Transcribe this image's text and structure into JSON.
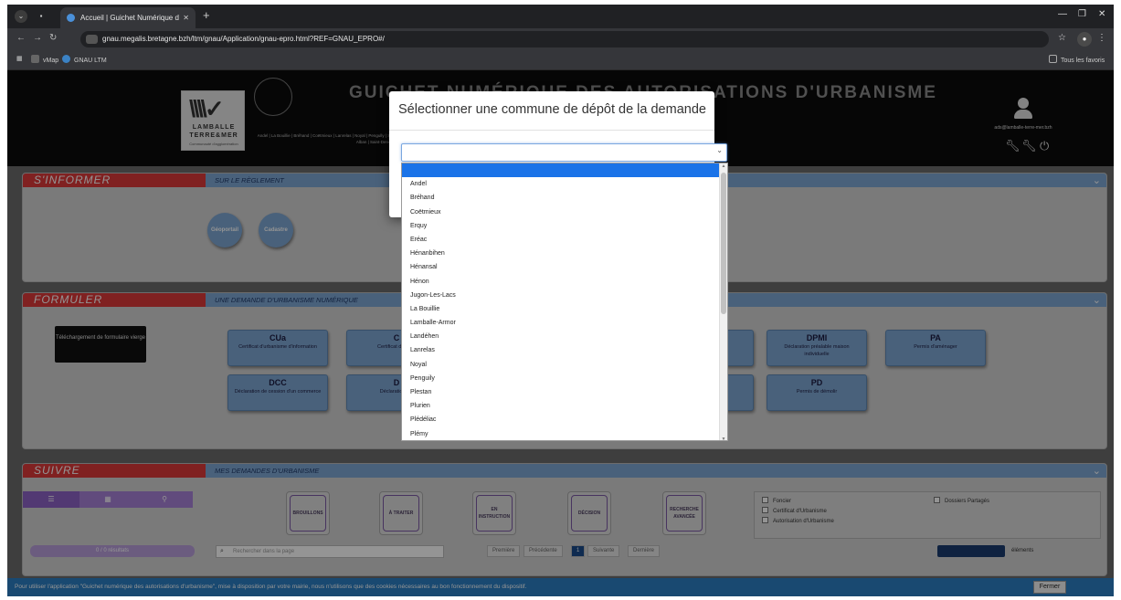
{
  "browser": {
    "tab_title": "Accueil | Guichet Numérique d",
    "url": "gnau.megalis.bretagne.bzh/ltm/gnau/Application/gnau-epro.html?REF=GNAU_EPRO#/",
    "bookmarks": [
      "vMap",
      "GNAU LTM"
    ],
    "all_bookmarks": "Tous les favoris"
  },
  "header": {
    "site_title": "GUICHET NUMÉRIQUE DES AUTORISATIONS D'URBANISME",
    "logo_line1": "LAMBALLE",
    "logo_line2": "TERRE&MER",
    "logo_line3": "Communauté d'agglomération",
    "communes": "Andel | La Bouillie | Bréhand | Coëtmieux | Lanrelas | Noyal | Pengully | Saint-Alban | Saint-Denoual |",
    "user_email": "ads@lamballe-terre-mer.bzh"
  },
  "s_informer": {
    "title": "S'INFORMER",
    "subtitle": "SUR LE RÈGLEMENT",
    "buttons": [
      "Géoportail",
      "Cadastre"
    ]
  },
  "formuler": {
    "title": "FORMULER",
    "subtitle": "UNE DEMANDE D'URBANISME NUMÉRIQUE",
    "download_label": "Téléchargement de formulaire vierge",
    "tiles": [
      {
        "code": "CUa",
        "desc": "Certificat d'urbanisme d'information"
      },
      {
        "code": "C",
        "desc": "Certificat d opéra"
      },
      {
        "code": "DPMI",
        "desc": "Déclaration préalable maison individuelle"
      },
      {
        "code": "PA",
        "desc": "Permis d'aménager"
      },
      {
        "code": "DCC",
        "desc": "Déclaration de cession d'un commerce"
      },
      {
        "code": "D",
        "desc": "Déclaration d'a"
      },
      {
        "code": "PD",
        "desc": "Permis de démolir"
      }
    ]
  },
  "suivre": {
    "title": "SUIVRE",
    "subtitle": "MES DEMANDES D'URBANISME",
    "status_buttons": [
      "BROUILLONS",
      "À TRAITER",
      "EN INSTRUCTION",
      "DÉCISION",
      "RECHERCHE AVANCÉE"
    ],
    "filters": [
      "Foncier",
      "Certificat d'Urbanisme",
      "Autorisation d'Urbanisme",
      "Dossiers Partagés"
    ],
    "results": "0 / 0 résultats",
    "search_placeholder": "Rechercher dans la page",
    "pagination": [
      "Première",
      "Précédente",
      "1",
      "Suivante",
      "Dernière"
    ],
    "elements_label": "éléments"
  },
  "cookie": {
    "text": "Pour utiliser l'application \"Guichet numérique des autorisations d'urbanisme\", mise à disposition par votre mairie, nous n'utilisons que des cookies nécessaires au bon fonctionnement du dispositif.",
    "close": "Fermer"
  },
  "modal": {
    "title": "Sélectionner une commune de dépôt de la demande",
    "selected_value": "",
    "options": [
      "",
      "Andel",
      "Bréhand",
      "Coëtmieux",
      "Erquy",
      "Eréac",
      "Hénanbihen",
      "Hénansal",
      "Hénon",
      "Jugon-Les-Lacs",
      "La Bouillie",
      "Lamballe-Armor",
      "Landéhen",
      "Lanrelas",
      "Noyal",
      "Penguily",
      "Plestan",
      "Plurien",
      "Plédéliac",
      "Plémy"
    ]
  }
}
